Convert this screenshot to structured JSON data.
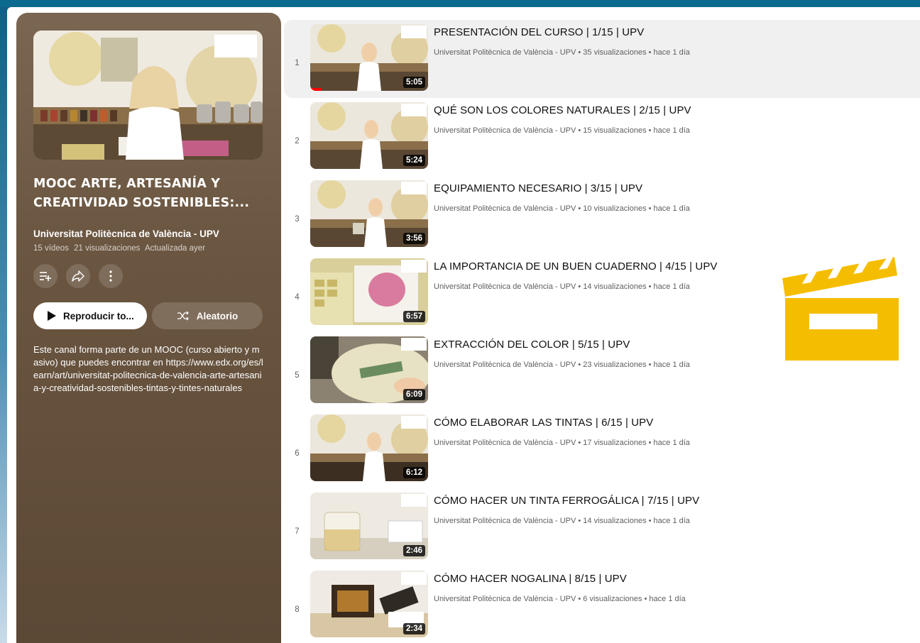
{
  "playlist": {
    "title": "MOOC ARTE, ARTESANÍA Y CREATIVIDAD SOSTENIBLES:...",
    "channel": "Universitat Politècnica de València - UPV",
    "video_count": "15 vídeos",
    "views": "21 visualizaciones",
    "updated": "Actualizada ayer",
    "play_all_label": "Reproducir to...",
    "shuffle_label": "Aleatorio",
    "description": "Este canal forma parte de un MOOC (curso abierto y masivo) que puedes encontrar en https://www.edx.org/es/learn/art/universitat-politecnica-de-valencia-arte-artesania-y-creatividad-sostenibles-tintas-y-tintes-naturales"
  },
  "videos": [
    {
      "index": "1",
      "title": "PRESENTACIÓN DEL CURSO | 1/15 | UPV",
      "meta": "Universitat Politècnica de València - UPV • 35 visualizaciones • hace 1 día",
      "duration": "5:05"
    },
    {
      "index": "2",
      "title": "QUÉ SON LOS COLORES NATURALES | 2/15 | UPV",
      "meta": "Universitat Politècnica de València - UPV • 15 visualizaciones • hace 1 día",
      "duration": "5:24"
    },
    {
      "index": "3",
      "title": "EQUIPAMIENTO NECESARIO | 3/15 | UPV",
      "meta": "Universitat Politècnica de València - UPV • 10 visualizaciones • hace 1 día",
      "duration": "3:56"
    },
    {
      "index": "4",
      "title": "LA IMPORTANCIA DE UN BUEN CUADERNO | 4/15 | UPV",
      "meta": "Universitat Politècnica de València - UPV • 14 visualizaciones • hace 1 día",
      "duration": "6:57"
    },
    {
      "index": "5",
      "title": "EXTRACCIÓN DEL COLOR | 5/15 | UPV",
      "meta": "Universitat Politècnica de València - UPV • 23 visualizaciones • hace 1 día",
      "duration": "6:09"
    },
    {
      "index": "6",
      "title": "CÓMO ELABORAR LAS TINTAS | 6/15 | UPV",
      "meta": "Universitat Politècnica de València - UPV • 17 visualizaciones • hace 1 día",
      "duration": "6:12"
    },
    {
      "index": "7",
      "title": "CÓMO HACER UN TINTA FERROGÁLICA | 7/15 | UPV",
      "meta": "Universitat Politècnica de València - UPV • 14 visualizaciones • hace 1 día",
      "duration": "2:46"
    },
    {
      "index": "8",
      "title": "CÓMO HACER NOGALINA | 8/15 | UPV",
      "meta": "Universitat Politècnica de València - UPV • 6 visualizaciones • hace 1 día",
      "duration": "2:34"
    }
  ],
  "icons": {
    "add_to_queue": "playlist-add-icon",
    "share": "share-icon",
    "more": "more-vert-icon",
    "play": "play-icon",
    "shuffle": "shuffle-icon",
    "clapperboard": "clapperboard-icon"
  },
  "colors": {
    "panel": "#6a5540",
    "clapperboard": "#f5bd00",
    "progress": "#ff0000"
  }
}
